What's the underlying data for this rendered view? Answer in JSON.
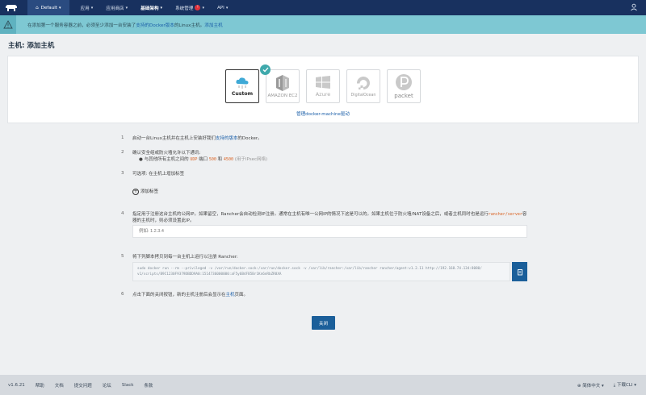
{
  "nav": {
    "environment": "Default",
    "items": [
      {
        "label": "应用"
      },
      {
        "label": "应用商店"
      },
      {
        "label": "基础架构"
      },
      {
        "label": "系统管理"
      },
      {
        "label": "API"
      }
    ],
    "alert_count": "!"
  },
  "banner": {
    "text_1": "在添加第一个服务容器之前，必须至少添加一台安装了",
    "link_1": "支持的Docker版本",
    "text_2": "的Linux主机。",
    "link_2": "添加主机"
  },
  "page": {
    "title": "主机: 添加主机"
  },
  "drivers": [
    {
      "label": "Custom"
    },
    {
      "label": "AMAZON EC2"
    },
    {
      "label": "Azure"
    },
    {
      "label": "DigitalOcean"
    },
    {
      "label": "packet"
    }
  ],
  "manage_drivers_link": "管理docker-machine驱动",
  "steps": {
    "s1": {
      "num": "1",
      "pre": "启动一台Linux主机并在主机上安装好我们",
      "link": "支持的版本",
      "post": "的Docker。"
    },
    "s2": {
      "num": "2",
      "text": "确认安全组或防火墙允许以下通讯:",
      "b_pre": "与其他所有主机之间的",
      "b_udp": "UDP",
      "b_port1": "端口",
      "b_500": "500",
      "b_and": "和",
      "b_4500": "4500",
      "b_note": "(用于IPsec网络)"
    },
    "s3": {
      "num": "3",
      "text": "可选项: 在主机上增加标签",
      "add_label": "添加标签"
    },
    "s4": {
      "num": "4",
      "text_1": "指定用于注册这台主机的公网IP。如果留空，Rancher会自动检测IP注册。通常在主机有唯一公网IP的情况下这是可以的。如果主机位于防火墙/NAT设备之后，或者主机同时也是运行",
      "code": "rancher/server",
      "text_2": "容器的主机时，则必须设置此IP。",
      "placeholder": "例如: 1.2.3.4"
    },
    "s5": {
      "num": "5",
      "text": "将下列脚本拷贝到每一台主机上运行以注册 Rancher:",
      "command_1": "sudo docker run --rm --privileged -v /var/run/docker.sock:/var/run/docker.sock -v /var/lib/rancher:/var/lib/rancher rancher/agent:v1.2.11 http://192.168.74.134:8080/",
      "command_2": "v1/scripts/B9C1230F9379DBDD9A0:1514736000000:aF5y6B4FB5Br1Kn6nRbZR8XA"
    },
    "s6": {
      "num": "6",
      "pre": "点击下面的关闭按钮，新的主机注册后会显示在",
      "link": "主机",
      "post": "页面。"
    }
  },
  "close_button": "关闭",
  "footer": {
    "version": "v1.6.21",
    "links": [
      "帮助",
      "文档",
      "提交问题",
      "论坛",
      "Slack",
      "条款"
    ],
    "language": "简体中文",
    "download": "下载CLI"
  }
}
